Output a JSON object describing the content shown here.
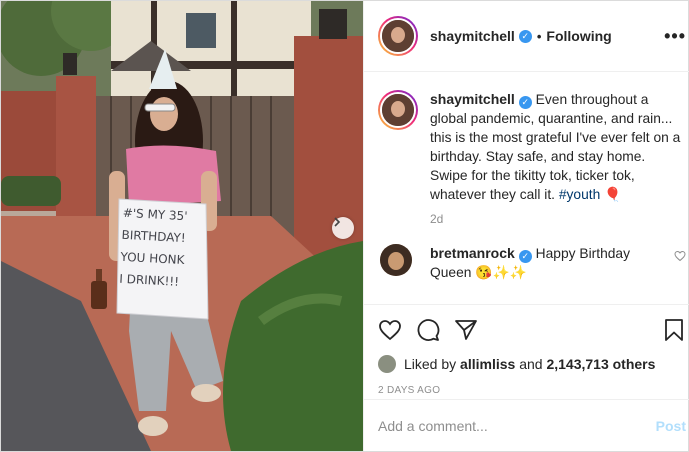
{
  "post": {
    "username": "shaymitchell",
    "follow_status": "Following",
    "dot": "•",
    "more_icon": "more-horizontal-icon"
  },
  "photo": {
    "sign_text_lines": [
      "#'S MY 35'",
      "BIRTHDAY!",
      "YOU HONK",
      "I DRINK!!!"
    ]
  },
  "caption": {
    "username": "shaymitchell",
    "text": "Even throughout a global pandemic, quarantine, and rain... this is the most grateful I've ever felt on a birthday. Stay safe, and stay home. Swipe for the tikitty tok, ticker tok, whatever they call it.",
    "hashtag": "#youth",
    "emoji": "🎈",
    "time": "2d"
  },
  "comment": {
    "username": "bretmanrock",
    "text": "Happy Birthday Queen",
    "emoji": "😘✨✨"
  },
  "actions": {
    "liked_by_prefix": "Liked by",
    "liked_by_user": "allimliss",
    "and_text": "and",
    "others_count": "2,143,713 others",
    "posted_ago": "2 DAYS AGO"
  },
  "comment_box": {
    "placeholder": "Add a comment...",
    "post_label": "Post"
  },
  "colors": {
    "verified": "#3897f0",
    "hashtag": "#00376b",
    "post_button_disabled": "#b2dffc",
    "secondary_text": "#8e8e8e"
  }
}
